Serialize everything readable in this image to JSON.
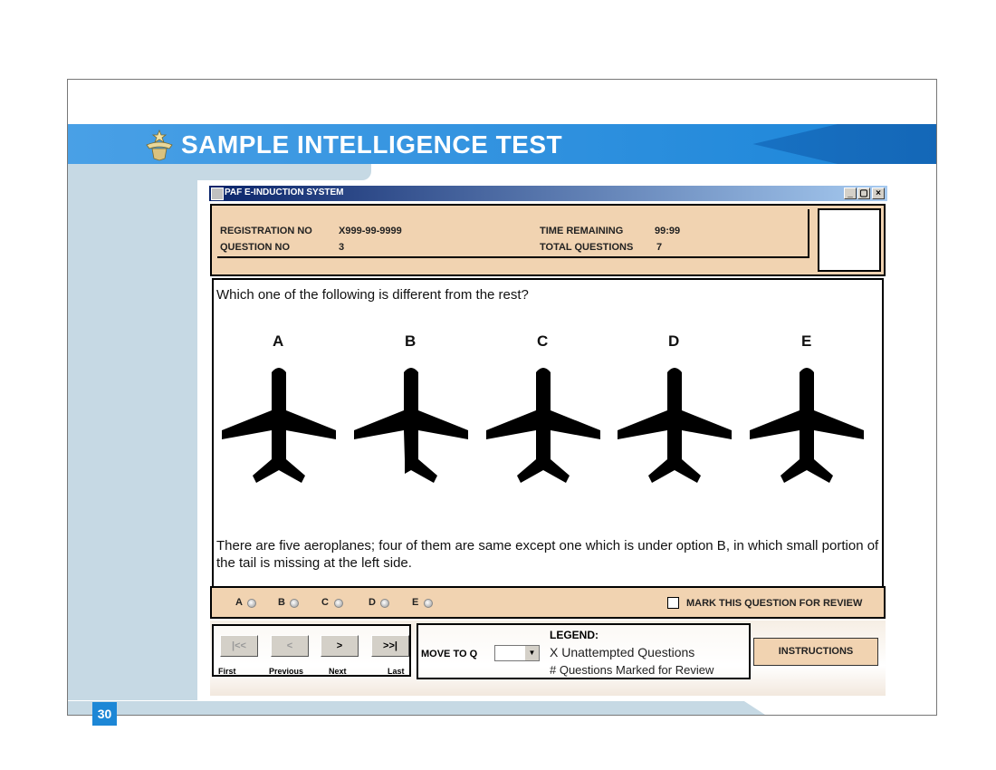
{
  "slide": {
    "title": "SAMPLE INTELLIGENCE TEST",
    "page_number": "30",
    "banner_color": "#1c7fd3",
    "panel_color": "#c6d9e4"
  },
  "window": {
    "title": "PAF E-INDUCTION SYSTEM",
    "controls": [
      "_",
      "▢",
      "×"
    ],
    "title_color": "#0a246a"
  },
  "info": {
    "registration_label": "REGISTRATION NO",
    "registration_value": "X999-99-9999",
    "question_label": "QUESTION NO",
    "question_value": "3",
    "time_label": "TIME REMAINING",
    "time_value": "99:99",
    "total_label": "TOTAL QUESTIONS",
    "total_value": "7",
    "panel_color": "#f1d3b1"
  },
  "question": {
    "text": "Which one of the following is different from the rest?",
    "options": [
      "A",
      "B",
      "C",
      "D",
      "E"
    ],
    "explanation": "There are five aeroplanes; four of them are same except one which is under option B, in which small portion of the tail is missing at the left side."
  },
  "answers": {
    "options": [
      "A",
      "B",
      "C",
      "D",
      "E"
    ],
    "mark_review_label": "MARK THIS QUESTION FOR REVIEW"
  },
  "nav": {
    "first_button": "|<<",
    "prev_button": "<",
    "next_button": ">",
    "last_button": ">>|",
    "first_caption": "First",
    "prev_caption": "Previous",
    "next_caption": "Next",
    "last_caption": "Last",
    "move_to_label": "MOVE TO Q",
    "legend_title": "LEGEND:",
    "legend_unattempted": "X Unattempted Questions",
    "legend_marked": "# Questions Marked for Review",
    "instructions_button": "INSTRUCTIONS"
  }
}
